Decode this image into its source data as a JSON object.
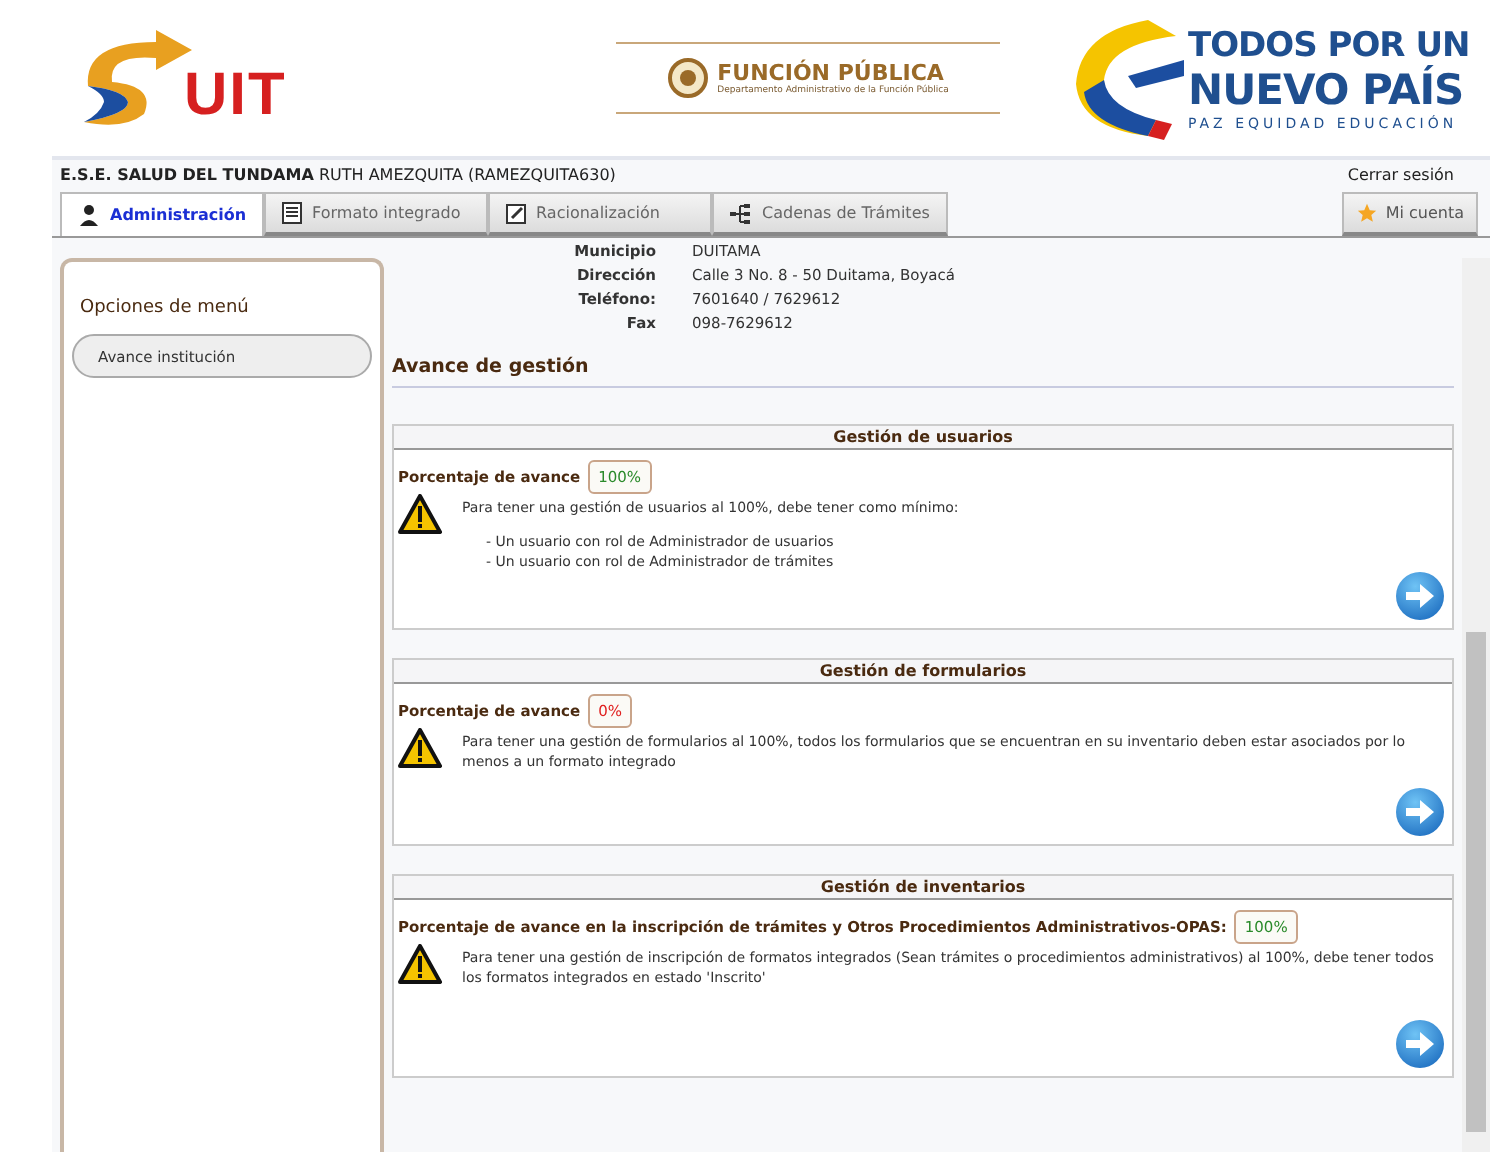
{
  "header": {
    "suit_logo": "UIT",
    "funcion_publica": {
      "title": "FUNCIÓN PÚBLICA",
      "subtitle": "Departamento Administrativo de la Función Pública"
    },
    "slogan": {
      "line1": "TODOS POR UN",
      "line2": "NUEVO PAÍS",
      "line3": "PAZ  EQUIDAD  EDUCACIÓN"
    }
  },
  "user_bar": {
    "entity": "E.S.E. SALUD DEL TUNDAMA",
    "user": "RUTH AMEZQUITA (RAMEZQUITA630)",
    "logout": "Cerrar sesión"
  },
  "tabs": [
    {
      "label": "Administración",
      "kind": "user",
      "selected": true
    },
    {
      "label": "Formato integrado",
      "kind": "doc",
      "selected": false
    },
    {
      "label": "Racionalización",
      "kind": "edit",
      "selected": false
    },
    {
      "label": "Cadenas de Trámites",
      "kind": "tree",
      "selected": false
    }
  ],
  "account_button": "Mi cuenta",
  "sidebar": {
    "title": "Opciones de menú",
    "items": [
      {
        "label": "Avance institución"
      }
    ]
  },
  "info": [
    {
      "label": "Municipio",
      "value": "DUITAMA"
    },
    {
      "label": "Dirección",
      "value": "Calle 3 No. 8 - 50 Duitama, Boyacá"
    },
    {
      "label": "Teléfono:",
      "value": "7601640 /  7629612"
    },
    {
      "label": "Fax",
      "value": "098-7629612"
    }
  ],
  "section_title": "Avance de gestión",
  "panels": [
    {
      "title": "Gestión de usuarios",
      "progress_label": "Porcentaje de avance",
      "progress": "100%",
      "complete": true,
      "message": "Para tener una gestión de usuarios al 100%, debe tener como mínimo:",
      "bullets": [
        "- Un usuario con rol de Administrador de usuarios",
        "- Un usuario con rol de Administrador de trámites"
      ]
    },
    {
      "title": "Gestión de formularios",
      "progress_label": "Porcentaje de avance",
      "progress": "0%",
      "complete": false,
      "message": "Para tener una gestión de formularios al 100%, todos los formularios que se encuentran en su inventario deben estar asociados por lo menos a un formato integrado"
    },
    {
      "title": "Gestión de inventarios",
      "progress_label": "Porcentaje de avance en la inscripción de trámites y Otros Procedimientos Administrativos-OPAS:",
      "progress": "100%",
      "complete": true,
      "message": "Para tener una gestión de inscripción de formatos integrados (Sean trámites o procedimientos administrativos) al 100%, debe tener todos los formatos integrados en estado 'Inscrito'"
    }
  ]
}
